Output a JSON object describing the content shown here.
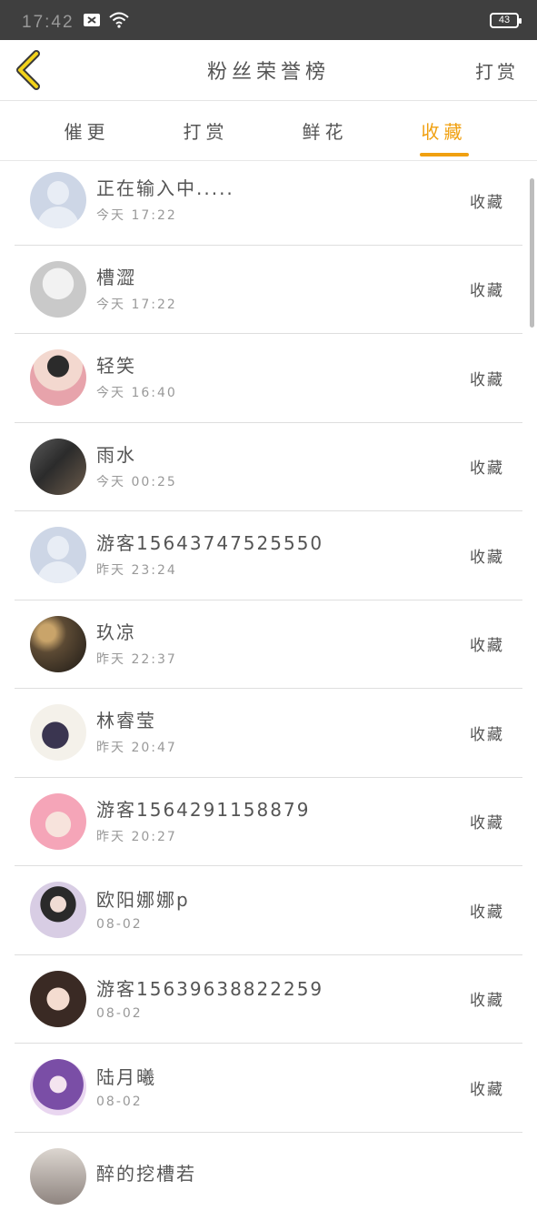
{
  "status_bar": {
    "time": "17:42",
    "battery": "43"
  },
  "header": {
    "title": "粉丝荣誉榜",
    "right_action": "打赏"
  },
  "tabs": [
    {
      "label": "催更",
      "active": false
    },
    {
      "label": "打赏",
      "active": false
    },
    {
      "label": "鲜花",
      "active": false
    },
    {
      "label": "收藏",
      "active": true
    }
  ],
  "rows": [
    {
      "name": "正在输入中.....",
      "time": "今天 17:22",
      "action": "收藏",
      "avatar": "default-avatar"
    },
    {
      "name": "槽澀",
      "time": "今天 17:22",
      "action": "收藏",
      "avatar": "photo-avatar"
    },
    {
      "name": "轻笑",
      "time": "今天 16:40",
      "action": "收藏",
      "avatar": "photo-avatar"
    },
    {
      "name": "雨水",
      "time": "今天 00:25",
      "action": "收藏",
      "avatar": "photo-avatar"
    },
    {
      "name": "游客15643747525550",
      "time": "昨天 23:24",
      "action": "收藏",
      "avatar": "default-avatar"
    },
    {
      "name": "玖凉",
      "time": "昨天 22:37",
      "action": "收藏",
      "avatar": "photo-avatar"
    },
    {
      "name": "林睿莹",
      "time": "昨天 20:47",
      "action": "收藏",
      "avatar": "photo-avatar"
    },
    {
      "name": "游客1564291158879",
      "time": "昨天 20:27",
      "action": "收藏",
      "avatar": "photo-avatar"
    },
    {
      "name": "欧阳娜娜p",
      "time": "08-02",
      "action": "收藏",
      "avatar": "photo-avatar"
    },
    {
      "name": "游客15639638822259",
      "time": "08-02",
      "action": "收藏",
      "avatar": "photo-avatar"
    },
    {
      "name": "陆月曦",
      "time": "08-02",
      "action": "收藏",
      "avatar": "photo-avatar"
    },
    {
      "name": "醉的挖槽若",
      "time": "",
      "action": "",
      "avatar": "photo-avatar"
    }
  ],
  "colors": {
    "accent": "#f0a010",
    "statusbar": "#3f3f3f"
  }
}
